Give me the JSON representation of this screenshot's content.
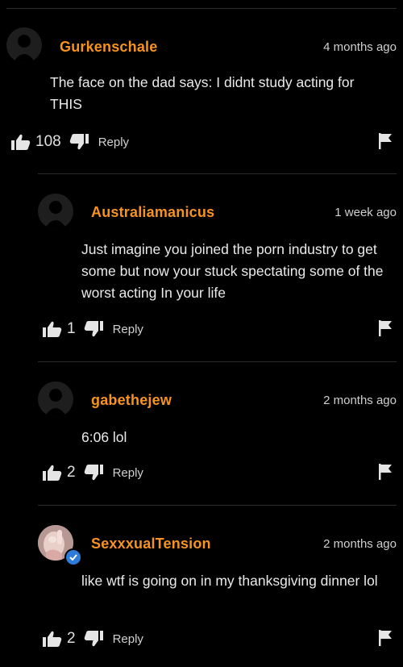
{
  "comments": [
    {
      "username": "Gurkenschale",
      "date": "4 months ago",
      "text": "The face on the dad says: I didnt study acting for THIS",
      "likes": "108",
      "reply_label": "Reply"
    },
    {
      "username": "Australiamanicus",
      "date": "1 week ago",
      "text": "Just imagine you joined the porn industry to get some but now your stuck spectating some of the worst acting In your life",
      "likes": "1",
      "reply_label": "Reply"
    },
    {
      "username": "gabethejew",
      "date": "2 months ago",
      "text": "6:06 lol",
      "likes": "2",
      "reply_label": "Reply"
    },
    {
      "username": "SexxxualTension",
      "date": "2 months ago",
      "text": "like wtf is going on in my thanksgiving dinner lol",
      "likes": "2",
      "reply_label": "Reply"
    }
  ],
  "icons": {
    "like": "thumbs-up-icon",
    "dislike": "thumbs-down-icon",
    "flag": "flag-icon",
    "avatar": "default-avatar-icon",
    "verified": "verified-checkmark-icon"
  },
  "colors": {
    "username": "#f7931e",
    "background": "#000000",
    "verified": "#2f7bd9"
  }
}
